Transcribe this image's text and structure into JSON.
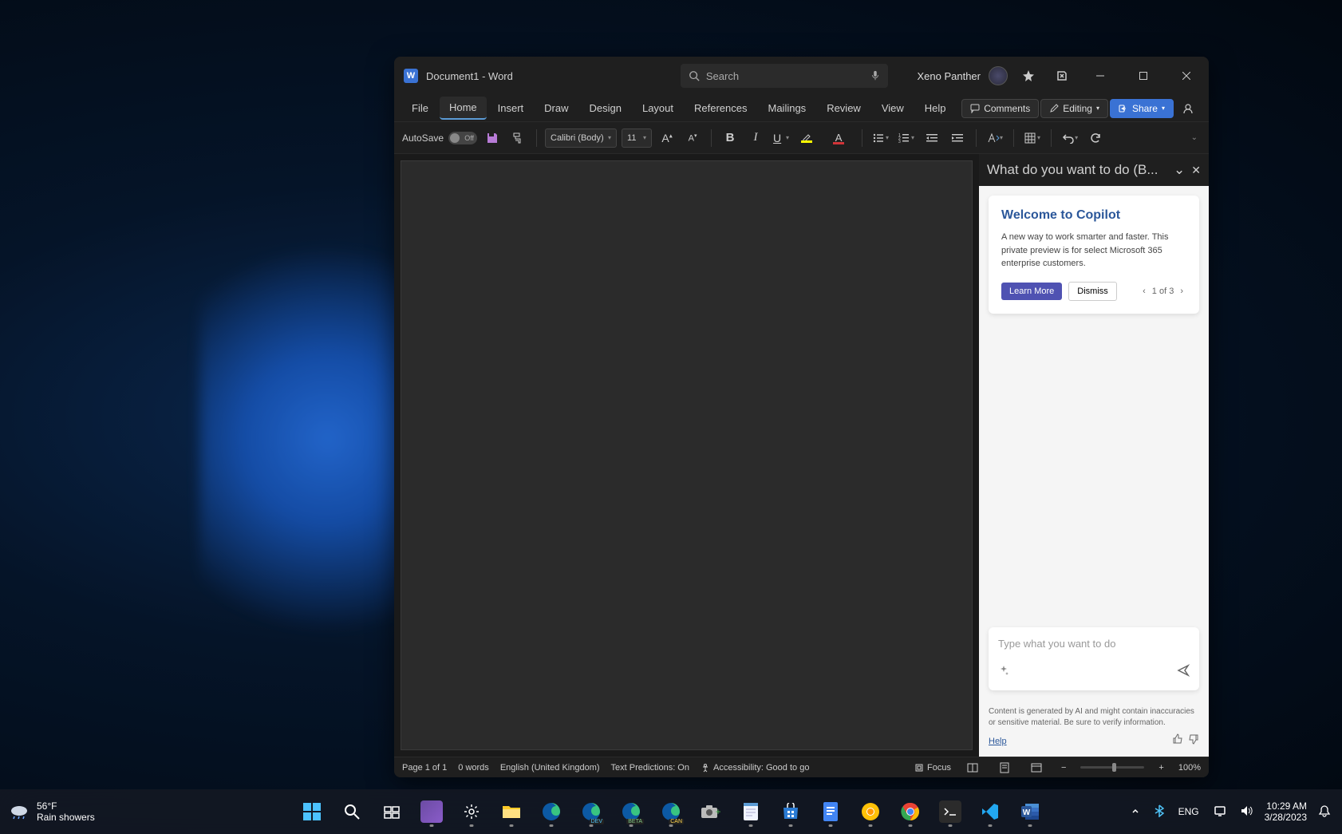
{
  "titlebar": {
    "doc_title": "Document1  -  Word",
    "search_placeholder": "Search",
    "user_name": "Xeno Panther"
  },
  "tabs": {
    "file": "File",
    "home": "Home",
    "insert": "Insert",
    "draw": "Draw",
    "design": "Design",
    "layout": "Layout",
    "references": "References",
    "mailings": "Mailings",
    "review": "Review",
    "view": "View",
    "help": "Help",
    "comments": "Comments",
    "editing": "Editing",
    "share": "Share"
  },
  "toolbar": {
    "autosave_label": "AutoSave",
    "autosave_state": "Off",
    "font_name": "Calibri (Body)",
    "font_size": "11"
  },
  "copilot": {
    "pane_title": "What do you want to do (B...",
    "welcome_title": "Welcome to Copilot",
    "welcome_text": "A new way to work smarter and faster. This private preview is for select Microsoft 365 enterprise customers.",
    "learn_more": "Learn More",
    "dismiss": "Dismiss",
    "pager_text": "1 of 3",
    "input_placeholder": "Type what you want to do",
    "disclaimer": "Content is generated by AI and might contain inaccuracies or sensitive material. Be sure to verify information.",
    "help_link": "Help"
  },
  "statusbar": {
    "page": "Page 1 of 1",
    "words": "0 words",
    "language": "English (United Kingdom)",
    "predictions": "Text Predictions: On",
    "accessibility": "Accessibility: Good to go",
    "focus": "Focus",
    "zoom": "100%"
  },
  "weather": {
    "temp": "56°F",
    "condition": "Rain showers"
  },
  "systray": {
    "lang": "ENG",
    "time": "10:29 AM",
    "date": "3/28/2023"
  }
}
